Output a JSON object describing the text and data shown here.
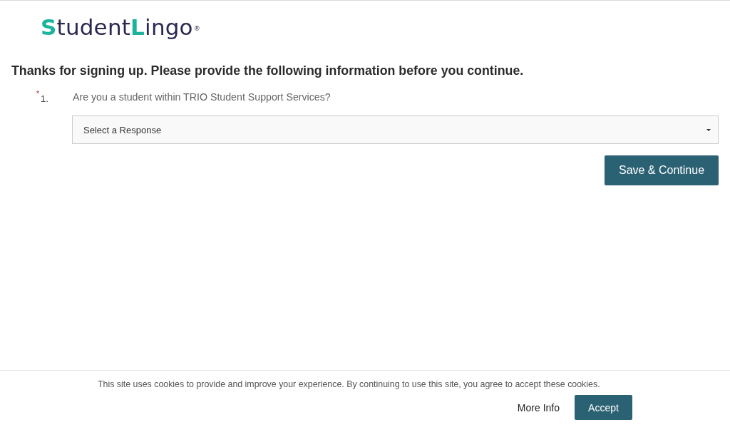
{
  "logo": {
    "segments": [
      {
        "text": "S",
        "accent": true
      },
      {
        "text": "tudent",
        "accent": false
      },
      {
        "text": "L",
        "accent": true
      },
      {
        "text": "ingo",
        "accent": false
      }
    ],
    "registered_mark": "®"
  },
  "heading": "Thanks for signing up. Please provide the following information before you continue.",
  "questions": [
    {
      "required": true,
      "required_mark": "*",
      "number": "1.",
      "text": "Are you a student within TRIO Student Support Services?",
      "select": {
        "placeholder": "Select a Response"
      }
    }
  ],
  "submit_button": "Save & Continue",
  "cookie_banner": {
    "message": "This site uses cookies to provide and improve your experience. By continuing to use this site, you agree to accept these cookies.",
    "more_info_link": "More Info",
    "accept_button": "Accept"
  }
}
